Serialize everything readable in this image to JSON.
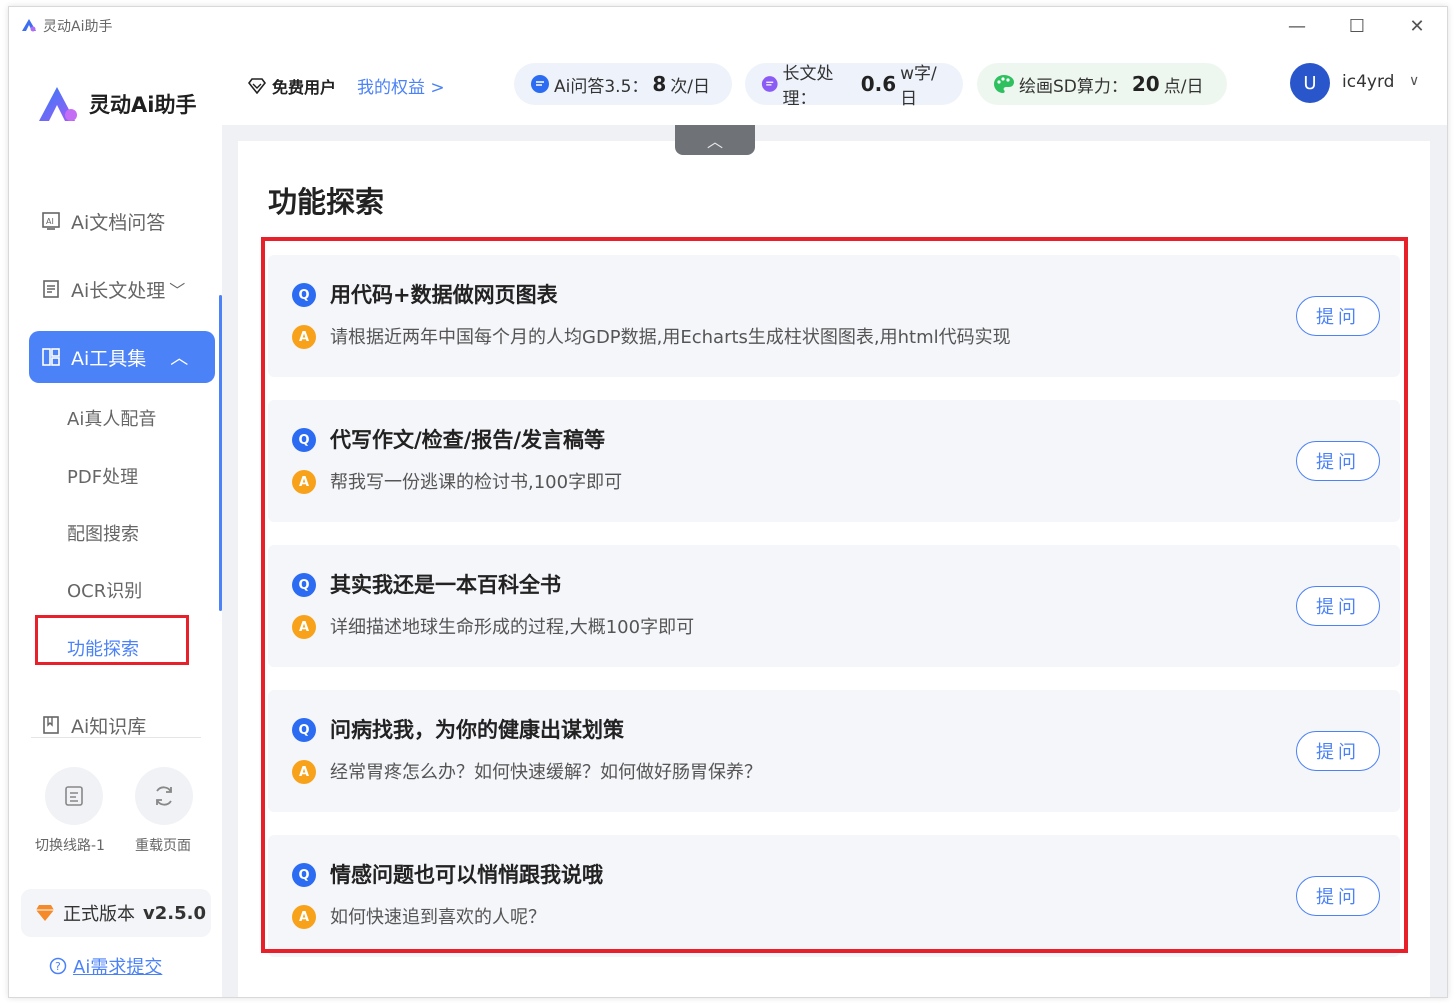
{
  "window": {
    "title": "灵动Ai助手",
    "min_icon": "—",
    "max_icon": "☐",
    "close_icon": "✕"
  },
  "sidebar": {
    "logo_text": "灵动Ai助手",
    "items": [
      {
        "label": "Ai文档问答",
        "icon": "doc-ai-icon"
      },
      {
        "label": "Ai长文处理",
        "icon": "file-icon",
        "chevron": "﹀"
      },
      {
        "label": "Ai工具集",
        "icon": "grid-icon",
        "chevron": "︿",
        "active": true
      },
      {
        "label": "Ai知识库",
        "icon": "book-icon"
      }
    ],
    "sub_items": [
      "Ai真人配音",
      "PDF处理",
      "配图搜索",
      "OCR识别",
      "功能探索"
    ],
    "selected_sub": "功能探索",
    "switch_label": "切换线路-1",
    "reload_label": "重载页面",
    "version_label": "正式版本",
    "version_number": "v2.5.0",
    "feedback_label": "Ai需求提交"
  },
  "header": {
    "user_type": "免费用户",
    "rights_link": "我的权益 >",
    "pills": [
      {
        "label": "Ai问答3.5：",
        "value": "8",
        "unit": "次/日",
        "icon": "chat-bubble-icon"
      },
      {
        "label": "长文处理：",
        "value": "0.6",
        "unit": "w字/日",
        "icon": "document-bubble-icon"
      },
      {
        "label": "绘画SD算力：",
        "value": "20",
        "unit": "点/日",
        "icon": "palette-icon"
      }
    ],
    "avatar_letter": "U",
    "username": "ic4yrd",
    "chevron": "∨"
  },
  "main": {
    "collapse_symbol": "︿",
    "title": "功能探索",
    "q_badge": "Q",
    "a_badge": "A",
    "ask_label": "提问",
    "cards": [
      {
        "question": "用代码+数据做网页图表",
        "answer": "请根据近两年中国每个月的人均GDP数据,用Echarts生成柱状图图表,用html代码实现"
      },
      {
        "question": "代写作文/检查/报告/发言稿等",
        "answer": "帮我写一份逃课的检讨书,100字即可"
      },
      {
        "question": "其实我还是一本百科全书",
        "answer": "详细描述地球生命形成的过程,大概100字即可"
      },
      {
        "question": "问病找我，为你的健康出谋划策",
        "answer": "经常胃疼怎么办？如何快速缓解？如何做好肠胃保养？"
      },
      {
        "question": "情感问题也可以悄悄跟我说哦",
        "answer": "如何快速追到喜欢的人呢？"
      }
    ]
  },
  "colors": {
    "accent": "#4c82f7",
    "highlight": "#e8202a",
    "answer_badge": "#f7a21a",
    "question_badge": "#2b6cf2"
  }
}
